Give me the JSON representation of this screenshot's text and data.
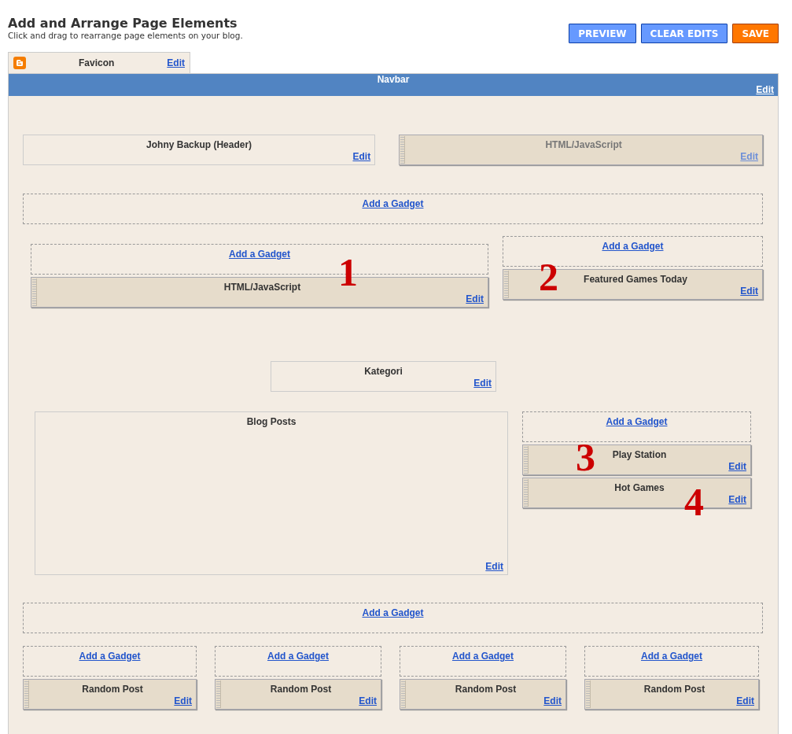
{
  "header": {
    "title": "Add and Arrange Page Elements",
    "subtitle": "Click and drag to rearrange page elements on your blog."
  },
  "buttons": [
    {
      "label": "PREVIEW",
      "kind": "primary"
    },
    {
      "label": "CLEAR EDITS",
      "kind": "primary"
    },
    {
      "label": "SAVE",
      "kind": "save"
    }
  ],
  "favicon": {
    "title": "Favicon",
    "edit": "Edit"
  },
  "navbar": {
    "title": "Navbar",
    "edit": "Edit"
  },
  "header_row": [
    {
      "kind": "fixed",
      "title": "Johny Backup (Header)",
      "edit": "Edit",
      "disabled": false
    },
    {
      "kind": "draggable",
      "title": "HTML/JavaScript",
      "edit": "Edit",
      "disabled": true
    }
  ],
  "crosscol": [
    {
      "kind": "add",
      "label": "Add a Gadget"
    }
  ],
  "main_top": {
    "left": [
      {
        "kind": "add",
        "label": "Add a Gadget"
      },
      {
        "kind": "draggable",
        "title": "HTML/JavaScript",
        "edit": "Edit",
        "disabled": false,
        "marker": "1"
      }
    ],
    "right": [
      {
        "kind": "add",
        "label": "Add a Gadget"
      },
      {
        "kind": "draggable",
        "title": "Featured Games Today",
        "edit": "Edit",
        "disabled": false,
        "marker": "2"
      }
    ]
  },
  "kategori": [
    {
      "kind": "fixed",
      "title": "Kategori",
      "edit": "Edit",
      "disabled": false
    }
  ],
  "main": {
    "posts": [
      {
        "kind": "fixed",
        "title": "Blog Posts",
        "edit": "Edit",
        "disabled": false
      }
    ],
    "sidebar": [
      {
        "kind": "add",
        "label": "Add a Gadget"
      },
      {
        "kind": "draggable",
        "title": "Play Station",
        "edit": "Edit",
        "disabled": false,
        "marker": "3"
      },
      {
        "kind": "draggable",
        "title": "Hot Games",
        "edit": "Edit",
        "disabled": false,
        "marker": "4"
      }
    ]
  },
  "footer": [
    {
      "kind": "add",
      "label": "Add a Gadget"
    }
  ],
  "footer_columns": [
    [
      {
        "kind": "add",
        "label": "Add a Gadget"
      },
      {
        "kind": "draggable",
        "title": "Random Post",
        "edit": "Edit",
        "disabled": false
      }
    ],
    [
      {
        "kind": "add",
        "label": "Add a Gadget"
      },
      {
        "kind": "draggable",
        "title": "Random Post",
        "edit": "Edit",
        "disabled": false
      }
    ],
    [
      {
        "kind": "add",
        "label": "Add a Gadget"
      },
      {
        "kind": "draggable",
        "title": "Random Post",
        "edit": "Edit",
        "disabled": false
      }
    ],
    [
      {
        "kind": "add",
        "label": "Add a Gadget"
      },
      {
        "kind": "draggable",
        "title": "Random Post",
        "edit": "Edit",
        "disabled": false
      }
    ]
  ]
}
